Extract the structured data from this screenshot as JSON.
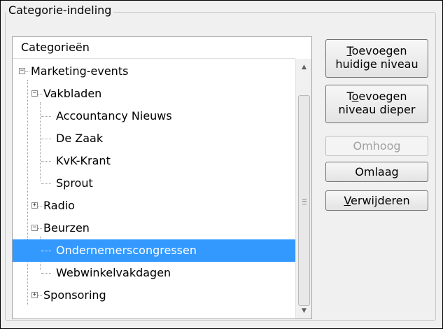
{
  "groupbox": {
    "title": "Categorie-indeling"
  },
  "tree": {
    "header": "Categorieën",
    "nodes": [
      {
        "label": "Marketing-events",
        "level": 0,
        "toggle": "−"
      },
      {
        "label": "Vakbladen",
        "level": 1,
        "toggle": "−"
      },
      {
        "label": "Accountancy Nieuws",
        "level": 2,
        "toggle": ""
      },
      {
        "label": "De Zaak",
        "level": 2,
        "toggle": ""
      },
      {
        "label": "KvK-Krant",
        "level": 2,
        "toggle": ""
      },
      {
        "label": "Sprout",
        "level": 2,
        "toggle": ""
      },
      {
        "label": "Radio",
        "level": 1,
        "toggle": "+"
      },
      {
        "label": "Beurzen",
        "level": 1,
        "toggle": "−"
      },
      {
        "label": "Ondernemerscongressen",
        "level": 2,
        "toggle": "",
        "selected": true
      },
      {
        "label": "Webwinkelvakdagen",
        "level": 2,
        "toggle": ""
      },
      {
        "label": "Sponsoring",
        "level": 1,
        "toggle": "+"
      }
    ],
    "scroll": {
      "up_icon": "▲",
      "down_icon": "▼"
    }
  },
  "buttons": {
    "add_current": {
      "line1_mnemonic": "T",
      "line1_rest": "oevoegen",
      "line2": "huidige niveau"
    },
    "add_deeper": {
      "line1_pre": "T",
      "line1_mnemonic": "o",
      "line1_rest": "evoegen",
      "line2": "niveau dieper"
    },
    "up": {
      "label": "Omhoog",
      "enabled": false
    },
    "down": {
      "label": "Omlaag"
    },
    "remove": {
      "mnemonic": "V",
      "rest": "erwijderen"
    }
  },
  "colors": {
    "selection": "#3399ff",
    "panel": "#f0f0f0"
  }
}
